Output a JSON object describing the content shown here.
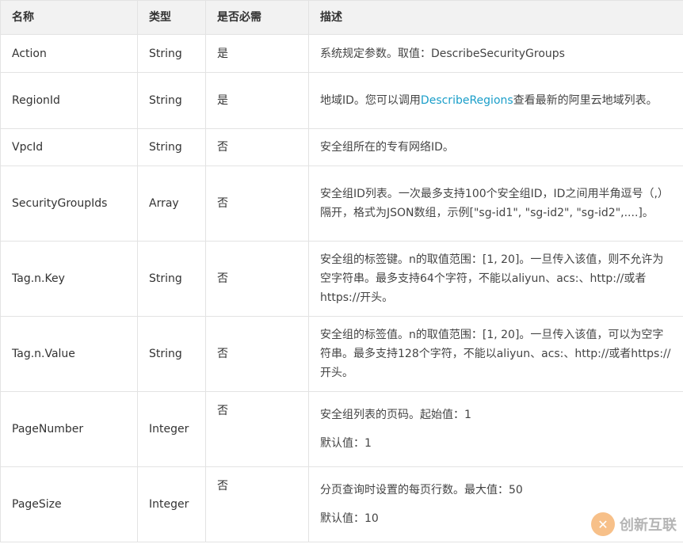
{
  "headers": [
    "名称",
    "类型",
    "是否必需",
    "描述"
  ],
  "rows": [
    {
      "name": "Action",
      "type": "String",
      "required": "是",
      "desc": "系统规定参数。取值：DescribeSecurityGroups"
    },
    {
      "name": "RegionId",
      "type": "String",
      "required": "是",
      "desc_pre": "地域ID。您可以调用",
      "desc_link": "DescribeRegions",
      "desc_post": "查看最新的阿里云地域列表。"
    },
    {
      "name": "VpcId",
      "type": "String",
      "required": "否",
      "desc": "安全组所在的专有网络ID。"
    },
    {
      "name": "SecurityGroupIds",
      "type": "Array",
      "required": "否",
      "desc": "安全组ID列表。一次最多支持100个安全组ID，ID之间用半角逗号（,）隔开，格式为JSON数组，示例[\"sg-id1\", \"sg-id2\", \"sg-id2\",....]。"
    },
    {
      "name": "Tag.n.Key",
      "type": "String",
      "required": "否",
      "desc": "安全组的标签键。n的取值范围：[1, 20]。一旦传入该值，则不允许为空字符串。最多支持64个字符，不能以aliyun、acs:、http://或者https://开头。"
    },
    {
      "name": "Tag.n.Value",
      "type": "String",
      "required": "否",
      "desc": "安全组的标签值。n的取值范围：[1, 20]。一旦传入该值，可以为空字符串。最多支持128个字符，不能以aliyun、acs:、http://或者https://开头。"
    },
    {
      "name": "PageNumber",
      "type": "Integer",
      "required": "否",
      "desc": "安全组列表的页码。起始值：1",
      "desc2": "默认值：1"
    },
    {
      "name": "PageSize",
      "type": "Integer",
      "required": "否",
      "desc": "分页查询时设置的每页行数。最大值：50",
      "desc2": "默认值：10"
    }
  ],
  "watermark": {
    "text": "创新互联",
    "icon": "logo-icon"
  }
}
